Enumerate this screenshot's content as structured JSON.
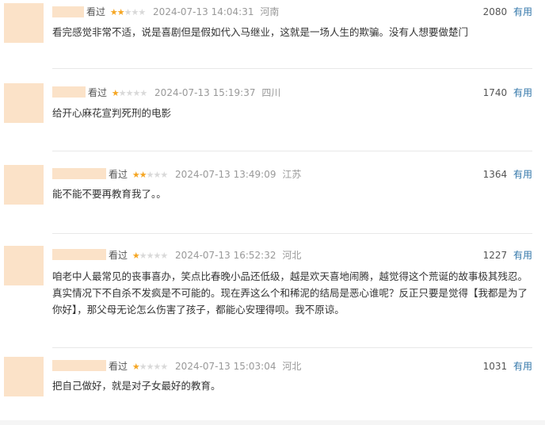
{
  "comments": [
    {
      "watched": "看过",
      "rating": 2,
      "timestamp": "2024-07-13 14:04:31",
      "location": "河南",
      "count": "2080",
      "useful": "有用",
      "content": "看完感觉非常不适，说是喜剧但是假如代入马继业，这就是一场人生的欺骗。没有人想要做楚门"
    },
    {
      "watched": "看过",
      "rating": 1,
      "timestamp": "2024-07-13 15:19:37",
      "location": "四川",
      "count": "1740",
      "useful": "有用",
      "content": "给开心麻花宣判死刑的电影"
    },
    {
      "watched": "看过",
      "rating": 2,
      "timestamp": "2024-07-13 13:49:09",
      "location": "江苏",
      "count": "1364",
      "useful": "有用",
      "content": "能不能不要再教育我了。。"
    },
    {
      "watched": "看过",
      "rating": 1,
      "timestamp": "2024-07-13 16:52:32",
      "location": "河北",
      "count": "1227",
      "useful": "有用",
      "content": "咱老中人最常见的丧事喜办，笑点比春晚小品还低级，越是欢天喜地闹腾，越觉得这个荒诞的故事极其残忍。真实情况下不自杀不发疯是不可能的。现在弄这么个和稀泥的结局是恶心谁呢？反正只要是觉得【我都是为了你好】，那父母无论怎么伤害了孩子，都能心安理得呗。我不原谅。"
    },
    {
      "watched": "看过",
      "rating": 1,
      "timestamp": "2024-07-13 15:03:04",
      "location": "河北",
      "count": "1031",
      "useful": "有用",
      "content": "把自己做好，就是对子女最好的教育。"
    }
  ],
  "colors": {
    "avatar_blur": "#fbe2c8",
    "star_on": "#f5a623",
    "star_off": "#d9d9d9",
    "useful_link": "#3377aa"
  }
}
